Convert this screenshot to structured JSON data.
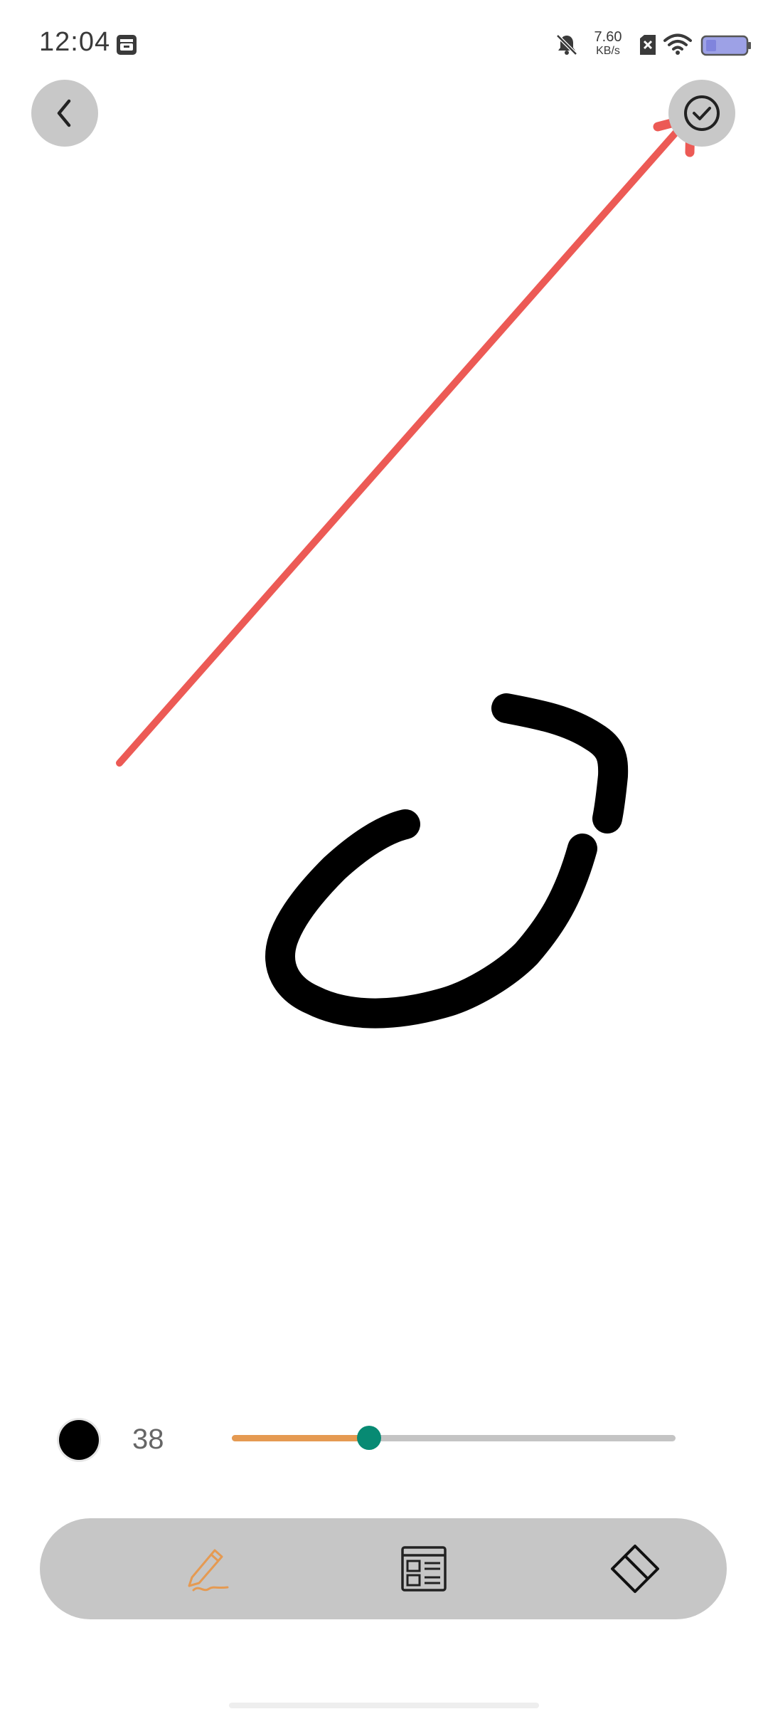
{
  "status_bar": {
    "time": "12:04",
    "net_speed_value": "7.60",
    "net_speed_unit": "KB/s",
    "icons": [
      "app-notification-icon",
      "mute-icon",
      "sim-icon",
      "wifi-icon",
      "battery-icon"
    ]
  },
  "header": {
    "back_icon": "chevron-left-icon",
    "confirm_icon": "check-circle-icon"
  },
  "brush": {
    "color": "#000000",
    "size_label": "38",
    "size_fraction": 0.31
  },
  "toolbar": {
    "tools": [
      {
        "name": "pen",
        "icon": "pen-icon",
        "active": true
      },
      {
        "name": "template",
        "icon": "template-icon",
        "active": false
      },
      {
        "name": "eraser",
        "icon": "eraser-icon",
        "active": false
      }
    ]
  },
  "colors": {
    "accent": "#e59a52",
    "thumb": "#078a73",
    "annotation": "#ec5a55",
    "stroke": "#000000"
  }
}
